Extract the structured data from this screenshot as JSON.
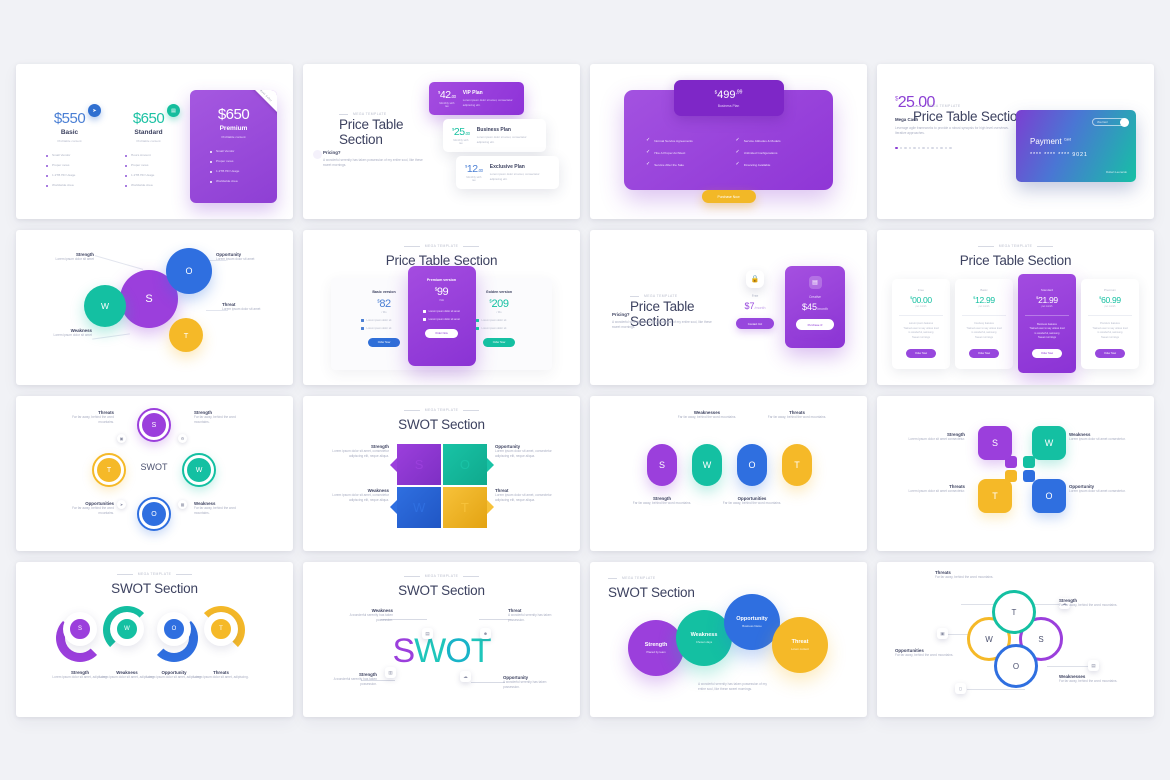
{
  "page": {
    "background": "#f1f2f6",
    "columns": 4,
    "rows": 4,
    "slide_count": 16
  },
  "palette": {
    "purple": "#9b3fdc",
    "teal": "#14c0a2",
    "blue": "#2f6fe0",
    "yellow": "#f5b928",
    "ink": "#3d4260",
    "muted": "#aab0c2"
  },
  "lorem": {
    "short": "Lorem ipsum dolor sit amet",
    "line": "Lorem ipsum dolor sit amet",
    "para": "Lorem ipsum dolor sit amet consectetur",
    "desc": "Lorem ipsum dolor sit amet, consectetur adipiscing elit",
    "tiny": "Lorem ipsum dolor"
  },
  "slides": [
    {
      "id": "pricing-three-column",
      "plans": [
        {
          "price": "$550",
          "name": "Basic",
          "subtitle": "Profitable content",
          "features": [
            "Small Vendor",
            "Proper news",
            "1.2TB HD Usage",
            "Worldwide Area"
          ]
        },
        {
          "price": "$650",
          "name": "Standard",
          "subtitle": "Profitable content",
          "features": [
            "Hours Amount",
            "Proper news",
            "1.2TB HD Usage",
            "Worldwide Area"
          ]
        },
        {
          "price": "$650",
          "name": "Premium",
          "subtitle": "Profitable content",
          "ribbon": "Best Seller",
          "features": [
            "Small Vendor",
            "Proper news",
            "1.2TB HD Usage",
            "Worldwide Area"
          ]
        }
      ],
      "badges": [
        "send-icon",
        "chart-icon"
      ]
    },
    {
      "id": "price-table-stacked-cards",
      "eyebrow": "Mega Template",
      "title": "Price Table Section",
      "question": "Pricing?",
      "question_body": "A wonderful serenity has taken possession of my entire soul, like these sweet mornings.",
      "plans": [
        {
          "cur": "$",
          "amt": "42",
          "dec": ".00",
          "per": "Monthly with tax",
          "name": "VIP Plan",
          "desc": "Lorem ipsum dolor sit amet, consectetur adipiscing elit."
        },
        {
          "cur": "$",
          "amt": "25",
          "dec": ".00",
          "per": "Monthly with tax",
          "name": "Business Plan",
          "desc": "Lorem ipsum dolor sit amet, consectetur adipiscing elit."
        },
        {
          "cur": "$",
          "amt": "12",
          "dec": ".00",
          "per": "Monthly with tax",
          "name": "Exclusive Plan",
          "desc": "Lorem ipsum dolor sit amet, consectetur adipiscing elit."
        }
      ]
    },
    {
      "id": "business-plan-single-card",
      "cur": "$",
      "amount": "499",
      "decimals": ",99",
      "plan_name": "Business Plan",
      "features": [
        "Normal Service Agreements",
        "Service Attitudes & Models",
        "Hire A Proper Architect",
        "Unlimited Configurations",
        "Service After the Sale",
        "Financing Available"
      ],
      "cta": "Purchase Now"
    },
    {
      "id": "price-table-payment-card",
      "eyebrow": "Mega Template",
      "title": "Price Table Section",
      "cur": "$",
      "price": "25.00",
      "label": "Mega Cash",
      "body": "Leverage agile frameworks to provide a robust synopsis for high level overviews. Iterative approaches.",
      "card": {
        "brand": "Payment",
        "brand_small": "Card",
        "number": "**** **** **** 9021",
        "holder": "Robert Leonardo",
        "button": "Visa Card"
      }
    },
    {
      "id": "swot-bubbles",
      "items": [
        {
          "letter": "S",
          "label": "Strength",
          "desc": "Lorem ipsum dolor sit amet"
        },
        {
          "letter": "W",
          "label": "Weakness",
          "desc": "Lorem ipsum dolor sit amet"
        },
        {
          "letter": "O",
          "label": "Opportunity",
          "desc": "Lorem ipsum dolor sit amet"
        },
        {
          "letter": "T",
          "label": "Threat",
          "desc": "Lorem ipsum dolor sit amet"
        }
      ]
    },
    {
      "id": "price-table-three-tier",
      "eyebrow": "Mega Template",
      "title": "Price Table Section",
      "plans": [
        {
          "title": "Basic version",
          "cur": "$",
          "amt": "82",
          "per": "/ Mo",
          "features": [
            "Lorem ipsum dolor sit",
            "Lorem ipsum dolor sit"
          ],
          "button": "Order Now"
        },
        {
          "title": "Premium version",
          "cur": "$",
          "amt": "99",
          "per": "/ Mo",
          "features": [
            "Lorem ipsum dolor sit amet",
            "Lorem ipsum dolor sit amet"
          ],
          "button": "Order Now"
        },
        {
          "title": "Golden version",
          "cur": "$",
          "amt": "209",
          "per": "/ Mo",
          "features": [
            "Lorem ipsum dolor sit",
            "Lorem ipsum dolor sit"
          ],
          "button": "Order Now"
        }
      ]
    },
    {
      "id": "price-table-free-vs-premium",
      "eyebrow": "Mega Template",
      "title": "Price Table Section",
      "question": "Pricing?",
      "question_body": "A wonderful serenity has taken possession of my entire soul, like these sweet mornings.",
      "free": {
        "icon": "lock-icon",
        "name": "Free",
        "price": "$7",
        "per": "/month",
        "button": "Contact Us!"
      },
      "premium": {
        "icon": "file-icon",
        "name": "Creative",
        "price": "$45",
        "per": "/month",
        "button": "Purchase it!"
      }
    },
    {
      "id": "price-table-four-tier",
      "eyebrow": "Mega Template",
      "title": "Price Table Section",
      "plans": [
        {
          "title": "Free",
          "cur": "$",
          "amt": "00.00",
          "per": "per month",
          "features": "Lorem ipsum features\nTrained even to say unless loud\nis wonderful, samsung\nSweet mornings",
          "button": "Order Now",
          "featured": false
        },
        {
          "title": "Basic",
          "cur": "$",
          "amt": "12.99",
          "per": "per month",
          "features": "Courtesy features\nTrained even to say unless loud\nis wonderful, samsung\nSweet mornings",
          "button": "Order Now",
          "featured": false
        },
        {
          "title": "Standard",
          "cur": "$",
          "amt": "21.99",
          "per": "per month",
          "features": "Business features\nTrained even to say unless loud\nis wonderful, samsung\nSweet mornings",
          "button": "Order Now",
          "featured": true
        },
        {
          "title": "Premium",
          "cur": "$",
          "amt": "60.99",
          "per": "per month",
          "features": "Premium features\nTrained even to say unless loud\nis wonderful, samsung\nSweet mornings",
          "button": "Order Now",
          "featured": false
        }
      ]
    },
    {
      "id": "swot-ring-diagram",
      "center": "SWOT",
      "items": [
        {
          "letter": "S",
          "label": "Strength",
          "desc": "Far far away, behind the word mountains."
        },
        {
          "letter": "W",
          "label": "Weakness",
          "desc": "Far far away, behind the word mountains."
        },
        {
          "letter": "O",
          "label": "Opportunities",
          "desc": "Far far away, behind the word mountains."
        },
        {
          "letter": "T",
          "label": "Threats",
          "desc": "Far far away, behind the word mountains."
        }
      ]
    },
    {
      "id": "swot-quadrant",
      "eyebrow": "Mega Template",
      "title": "SWOT Section",
      "items": [
        {
          "letter": "S",
          "label": "Strength",
          "desc": "Lorem ipsum dolor sit amet, consectetur adipiscing elit, neque aliqua."
        },
        {
          "letter": "O",
          "label": "Opportunity",
          "desc": "Lorem ipsum dolor sit amet, consectetur adipiscing elit, neque aliqua."
        },
        {
          "letter": "W",
          "label": "Weakness",
          "desc": "Lorem ipsum dolor sit amet, consectetur adipiscing elit, neque aliqua."
        },
        {
          "letter": "T",
          "label": "Threat",
          "desc": "Lorem ipsum dolor sit amet, consectetur adipiscing elit, neque aliqua."
        }
      ]
    },
    {
      "id": "swot-pills",
      "items": [
        {
          "letter": "S",
          "label": "Strength",
          "desc": "Far far away, behind the word mountains."
        },
        {
          "letter": "W",
          "label": "Weaknesses",
          "desc": "Far far away, behind the word mountains."
        },
        {
          "letter": "O",
          "label": "Opportunities",
          "desc": "Far far away, behind the word mountains."
        },
        {
          "letter": "T",
          "label": "Threats",
          "desc": "Far far away, behind the word mountains."
        }
      ]
    },
    {
      "id": "swot-interlocking-squares",
      "items": [
        {
          "letter": "S",
          "label": "Strength",
          "desc": "Lorem ipsum dolor sit amet consectetur."
        },
        {
          "letter": "W",
          "label": "Weakness",
          "desc": "Lorem ipsum dolor sit amet consectetur."
        },
        {
          "letter": "T",
          "label": "Threats",
          "desc": "Lorem ipsum dolor sit amet consectetur."
        },
        {
          "letter": "O",
          "label": "Opportunity",
          "desc": "Lorem ipsum dolor sit amet consectetur."
        }
      ]
    },
    {
      "id": "swot-arc-steps",
      "eyebrow": "Mega Template",
      "title": "SWOT Section",
      "items": [
        {
          "letter": "S",
          "label": "Strength",
          "desc": "Lorem ipsum dolor sit amet, adipiscing."
        },
        {
          "letter": "W",
          "label": "Weakness",
          "desc": "Lorem ipsum dolor sit amet, adipiscing."
        },
        {
          "letter": "O",
          "label": "Opportunity",
          "desc": "Lorem ipsum dolor sit amet, adipiscing."
        },
        {
          "letter": "T",
          "label": "Threats",
          "desc": "Lorem ipsum dolor sit amet, adipiscing."
        }
      ]
    },
    {
      "id": "swot-wordmark",
      "eyebrow": "Mega Template",
      "title": "SWOT Section",
      "word": "SWOT",
      "items": [
        {
          "label": "Weakness",
          "desc": "A wonderful serenity has taken possession."
        },
        {
          "label": "Threat",
          "desc": "A wonderful serenity has taken possession."
        },
        {
          "label": "Strength",
          "desc": "A wonderful serenity has taken possession."
        },
        {
          "label": "Opportunity",
          "desc": "A wonderful serenity has taken possession."
        }
      ]
    },
    {
      "id": "swot-overlapping-circles",
      "eyebrow": "Mega Template",
      "title": "SWOT Section",
      "items": [
        {
          "label": "Strength",
          "sub": "Placed by team"
        },
        {
          "label": "Weakness",
          "sub": "Chosen days"
        },
        {
          "label": "Opportunity",
          "sub": "Business Name"
        },
        {
          "label": "Threat",
          "sub": "Lorem content"
        }
      ],
      "body": "A wonderful serenity has taken possession of my entire soul, like these sweet mornings."
    },
    {
      "id": "swot-venn-rings",
      "items": [
        {
          "letter": "T",
          "label": "Threats",
          "desc": "Far far away, behind the word mountains."
        },
        {
          "letter": "S",
          "label": "Strength",
          "desc": "Far far away, behind the word mountains."
        },
        {
          "letter": "W",
          "label": "Opportunities",
          "desc": "Far far away, behind the word mountains."
        },
        {
          "letter": "O",
          "label": "Weaknesses",
          "desc": "Far far away, behind the word mountains."
        }
      ]
    }
  ]
}
